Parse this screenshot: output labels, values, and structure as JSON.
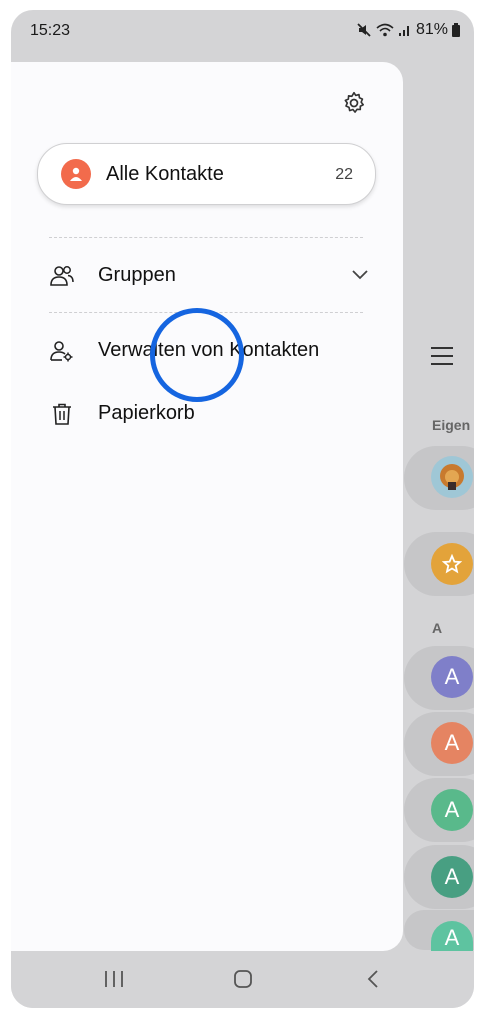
{
  "status_bar": {
    "time": "15:23",
    "battery": "81%"
  },
  "drawer": {
    "all_contacts": {
      "label": "Alle Kontakte",
      "count": "22"
    },
    "items": [
      {
        "label": "Gruppen",
        "icon": "groups-icon"
      },
      {
        "label": "Verwalten von Kontakten",
        "icon": "manage-contacts-icon"
      },
      {
        "label": "Papierkorb",
        "icon": "trash-icon"
      }
    ]
  },
  "background_list": {
    "section_own": "Eigen",
    "section_a": "A",
    "avatar_letter": "A"
  },
  "colors": {
    "accent": "#1565e0",
    "all_contacts_avatar": "#f26b4c",
    "favorite": "#e3a33a",
    "avatars": [
      "#7f7fc9",
      "#e58462",
      "#59b98b",
      "#489f82",
      "#5ec3a0"
    ]
  }
}
